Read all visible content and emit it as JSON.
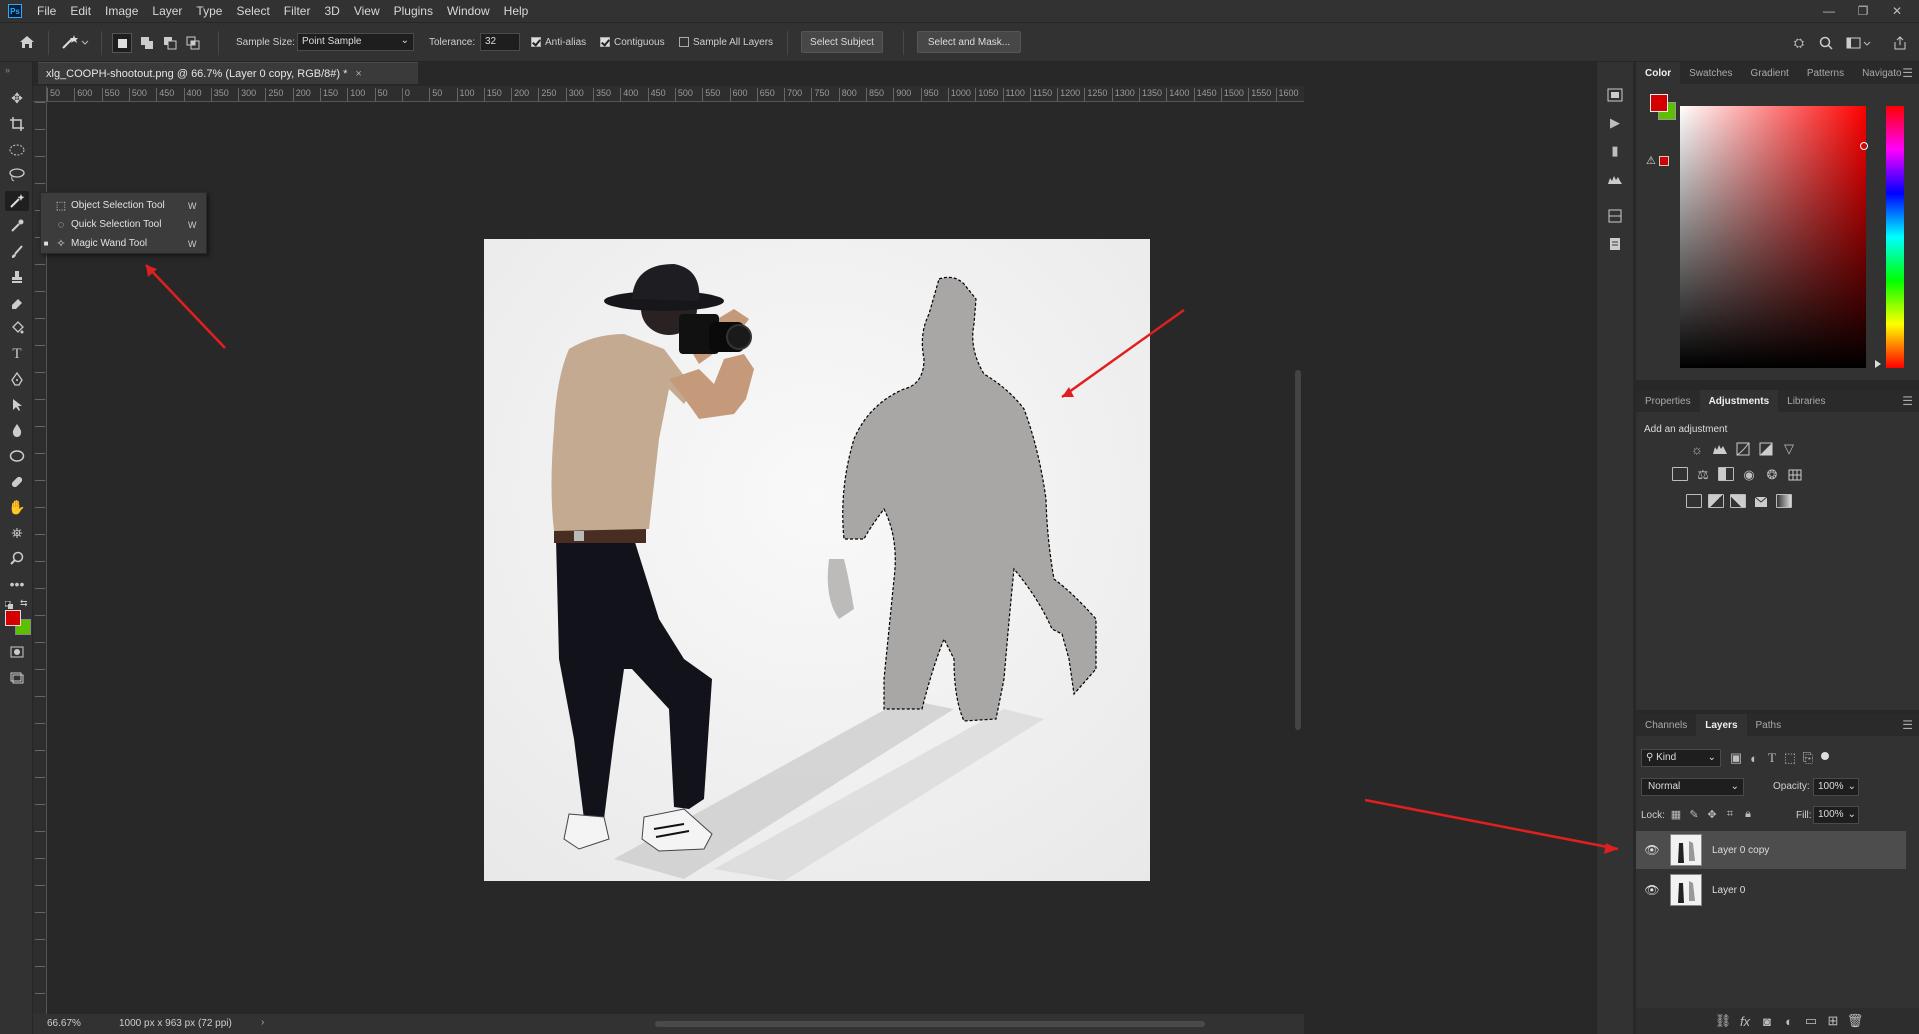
{
  "app": {
    "logo_text": "Ps"
  },
  "menu": [
    "File",
    "Edit",
    "Image",
    "Layer",
    "Type",
    "Select",
    "Filter",
    "3D",
    "View",
    "Plugins",
    "Window",
    "Help"
  ],
  "window_controls": {
    "minimize": "—",
    "restore": "❐",
    "close": "✕"
  },
  "options": {
    "sample_size_label": "Sample Size:",
    "sample_size_value": "Point Sample",
    "tolerance_label": "Tolerance:",
    "tolerance_value": "32",
    "anti_alias": "Anti-alias",
    "contiguous": "Contiguous",
    "sample_all_layers": "Sample All Layers",
    "select_subject": "Select Subject",
    "select_and_mask": "Select and Mask..."
  },
  "document": {
    "tab_title": "xlg_COOPH-shootout.png @ 66.7% (Layer 0 copy, RGB/8#) *",
    "close": "×"
  },
  "ruler_h": [
    "50",
    "600",
    "550",
    "500",
    "450",
    "400",
    "350",
    "300",
    "250",
    "200",
    "150",
    "100",
    "50",
    "0",
    "50",
    "100",
    "150",
    "200",
    "250",
    "300",
    "350",
    "400",
    "450",
    "500",
    "550",
    "600",
    "650",
    "700",
    "750",
    "800",
    "850",
    "900",
    "950",
    "1000",
    "1050",
    "1100",
    "1150",
    "1200",
    "1250",
    "1300",
    "1350",
    "1400",
    "1450",
    "1500",
    "1550",
    "1600"
  ],
  "flyout": {
    "items": [
      {
        "label": "Object Selection Tool",
        "key": "W",
        "selected": false
      },
      {
        "label": "Quick Selection Tool",
        "key": "W",
        "selected": false
      },
      {
        "label": "Magic Wand Tool",
        "key": "W",
        "selected": true
      }
    ]
  },
  "status": {
    "zoom": "66.67%",
    "doc_info": "1000 px x 963 px (72 ppi)",
    "arrow": "›"
  },
  "color_panel": {
    "tabs": [
      "Color",
      "Swatches",
      "Gradient",
      "Patterns",
      "Navigato"
    ],
    "foreground": "#d40000",
    "background": "#5cbf00"
  },
  "adjust_panel": {
    "tabs": [
      "Properties",
      "Adjustments",
      "Libraries"
    ],
    "add_label": "Add an adjustment"
  },
  "layers_panel": {
    "tabs": [
      "Channels",
      "Layers",
      "Paths"
    ],
    "filter_kind": "Kind",
    "blend_mode": "Normal",
    "opacity_label": "Opacity:",
    "opacity_value": "100%",
    "lock_label": "Lock:",
    "fill_label": "Fill:",
    "fill_value": "100%",
    "layers": [
      {
        "name": "Layer 0 copy",
        "selected": true
      },
      {
        "name": "Layer 0",
        "selected": false
      }
    ]
  },
  "colors": {
    "accent_arrow": "#e02020",
    "panel_bg": "#323232",
    "canvas_bg": "#282828"
  }
}
